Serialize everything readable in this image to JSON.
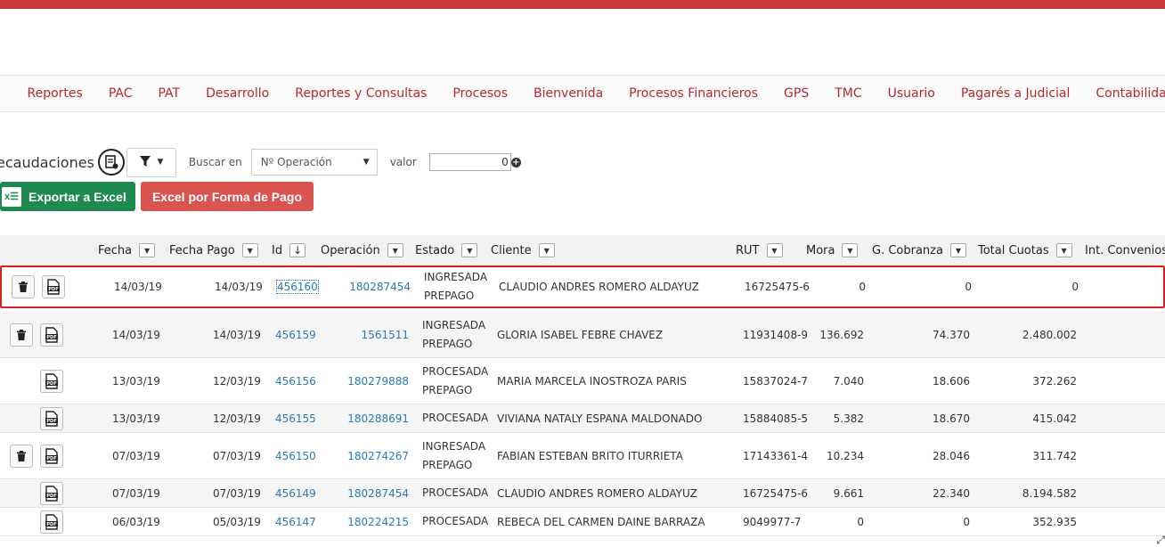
{
  "nav": [
    {
      "label": "Reportes"
    },
    {
      "label": "PAC"
    },
    {
      "label": "PAT"
    },
    {
      "label": "Desarrollo"
    },
    {
      "label": "Reportes y Consultas"
    },
    {
      "label": "Procesos"
    },
    {
      "label": "Bienvenida"
    },
    {
      "label": "Procesos Financieros"
    },
    {
      "label": "GPS"
    },
    {
      "label": "TMC"
    },
    {
      "label": "Usuario"
    },
    {
      "label": "Pagarés a Judicial"
    },
    {
      "label": "Contabilidad"
    }
  ],
  "toolbar": {
    "title": "ecaudaciones",
    "buscar_label": "Buscar en",
    "buscar_selected": "Nº Operación",
    "valor_label": "valor",
    "valor_value": "0"
  },
  "buttons": {
    "export_excel": "Exportar a Excel",
    "excel_forma_pago": "Excel por Forma de Pago"
  },
  "columns": {
    "fecha": "Fecha",
    "fecha_pago": "Fecha Pago",
    "id": "Id",
    "operacion": "Operación",
    "estado": "Estado",
    "cliente": "Cliente",
    "rut": "RUT",
    "mora": "Mora",
    "g_cobranza": "G. Cobranza",
    "total_cuotas": "Total Cuotas",
    "int_convenios": "Int. Convenios"
  },
  "rows": [
    {
      "fecha": "14/03/19",
      "fecha_pago": "14/03/19",
      "id": "456160",
      "operacion": "180287454",
      "estado": [
        "INGRESADA",
        "PREPAGO"
      ],
      "cliente": "CLAUDIO ANDRES ROMERO ALDAYUZ",
      "rut": "16725475-6",
      "mora": "0",
      "g_cobranza": "0",
      "total_cuotas": "0",
      "trash": true,
      "selected": true
    },
    {
      "fecha": "14/03/19",
      "fecha_pago": "14/03/19",
      "id": "456159",
      "operacion": "1561511",
      "estado": [
        "INGRESADA",
        "PREPAGO"
      ],
      "cliente": "GLORIA ISABEL FEBRE CHAVEZ",
      "rut": "11931408-9",
      "mora": "136.692",
      "g_cobranza": "74.370",
      "total_cuotas": "2.480.002",
      "trash": true
    },
    {
      "fecha": "13/03/19",
      "fecha_pago": "12/03/19",
      "id": "456156",
      "operacion": "180279888",
      "estado": [
        "PROCESADA",
        "PREPAGO"
      ],
      "cliente": "MARIA MARCELA INOSTROZA PARIS",
      "rut": "15837024-7",
      "mora": "7.040",
      "g_cobranza": "18.606",
      "total_cuotas": "372.262",
      "trash": false
    },
    {
      "fecha": "13/03/19",
      "fecha_pago": "12/03/19",
      "id": "456155",
      "operacion": "180288691",
      "estado": [
        "PROCESADA"
      ],
      "cliente": "VIVIANA NATALY ESPANA MALDONADO",
      "rut": "15884085-5",
      "mora": "5.382",
      "g_cobranza": "18.670",
      "total_cuotas": "415.042",
      "trash": false
    },
    {
      "fecha": "07/03/19",
      "fecha_pago": "07/03/19",
      "id": "456150",
      "operacion": "180274267",
      "estado": [
        "INGRESADA",
        "PREPAGO"
      ],
      "cliente": "FABIAN ESTEBAN BRITO ITURRIETA",
      "rut": "17143361-4",
      "mora": "10.234",
      "g_cobranza": "28.046",
      "total_cuotas": "311.742",
      "trash": true
    },
    {
      "fecha": "07/03/19",
      "fecha_pago": "07/03/19",
      "id": "456149",
      "operacion": "180287454",
      "estado": [
        "PROCESADA"
      ],
      "cliente": "CLAUDIO ANDRES ROMERO ALDAYUZ",
      "rut": "16725475-6",
      "mora": "9.661",
      "g_cobranza": "22.340",
      "total_cuotas": "8.194.582",
      "trash": false
    },
    {
      "fecha": "06/03/19",
      "fecha_pago": "05/03/19",
      "id": "456147",
      "operacion": "180224215",
      "estado": [
        "PROCESADA"
      ],
      "cliente": "REBECA DEL CARMEN DAINE BARRAZA",
      "rut": "9049977-7",
      "mora": "0",
      "g_cobranza": "0",
      "total_cuotas": "352.935",
      "trash": false
    }
  ]
}
